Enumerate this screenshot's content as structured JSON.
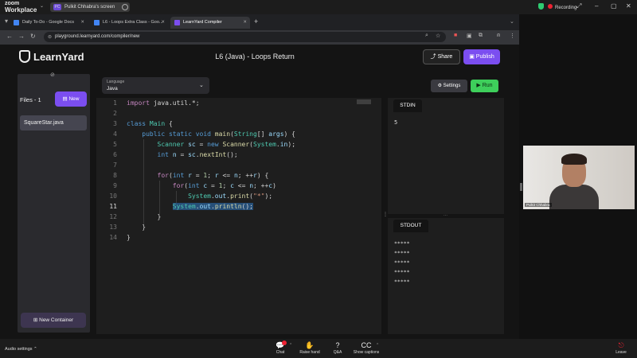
{
  "zoom": {
    "logo_line1": "zoom",
    "logo_line2": "Workplace",
    "share_badge": "PC",
    "share_label": "Pulkit Chhabra's screen",
    "recording": "Recording",
    "audio_settings": "Audio settings",
    "toolbar": [
      {
        "icon": "💬",
        "label": "Chat"
      },
      {
        "icon": "✋",
        "label": "Raise hand"
      },
      {
        "icon": "?",
        "label": "Q&A"
      },
      {
        "icon": "CC",
        "label": "Show captions"
      }
    ],
    "leave": "Leave",
    "video_name": "Pulkit Chhabra"
  },
  "browser": {
    "tabs": [
      {
        "label": "Daily To-Do - Google Docs"
      },
      {
        "label": "L6 - Loops Extra Class - Goo..."
      },
      {
        "label": "LearnYard Compiler"
      }
    ],
    "url": "playground.learnyard.com/compiler/new"
  },
  "app": {
    "logo": "LearnYard",
    "title": "L6 (Java) - Loops Return",
    "share": "Share",
    "publish": "Publish",
    "files_label": "Files - 1",
    "new_label": "New",
    "file_name": "SquareStar.java",
    "new_container": "New Container",
    "language_label": "Language",
    "language_value": "Java",
    "settings": "Settings",
    "run": "Run",
    "stdin_label": "STDIN",
    "stdin_value": "5",
    "stdout_label": "STDOUT",
    "stdout_lines": [
      "*****",
      "*****",
      "*****",
      "*****",
      "*****"
    ]
  },
  "editor": {
    "line_numbers": [
      "1",
      "2",
      "3",
      "4",
      "5",
      "6",
      "7",
      "8",
      "9",
      "10",
      "11",
      "12",
      "13",
      "14"
    ],
    "current_line": "11"
  },
  "colors": {
    "accent": "#7b4ef0",
    "run": "#3ecf5b",
    "recording": "#e22233"
  }
}
